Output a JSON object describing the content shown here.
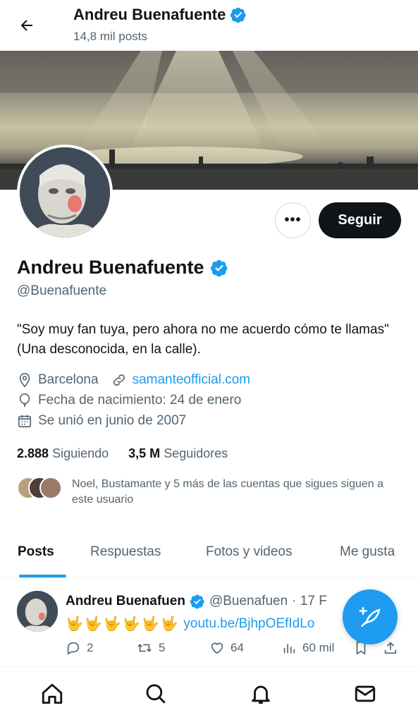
{
  "header": {
    "name": "Andreu Buenafuente",
    "posts_count": "14,8 mil posts"
  },
  "profile": {
    "name": "Andreu Buenafuente",
    "handle": "@Buenafuente",
    "bio": "\"Soy muy fan tuya, pero ahora no me acuerdo cómo te llamas\" (Una desconocida, en la calle).",
    "location": "Barcelona",
    "website": "samanteofficial.com",
    "birthday": "Fecha de nacimiento: 24 de enero",
    "joined": "Se unió en junio de 2007",
    "following_count": "2.888",
    "following_label": "Siguiendo",
    "followers_count": "3,5 M",
    "followers_label": "Seguidores",
    "known_followers": "Noel, Bustamante y 5 más de las cuentas que sigues siguen a este usuario"
  },
  "actions": {
    "more": "•••",
    "follow": "Seguir"
  },
  "tabs": [
    "Posts",
    "Respuestas",
    "Fotos y videos",
    "Me gusta"
  ],
  "tweet": {
    "name": "Andreu Buenafuen",
    "handle": "@Buenafuen",
    "time": "· 17 F",
    "emojis": "🤟🤟🤟🤟🤟🤟",
    "link": "youtu.be/BjhpOEfIdLo",
    "replies": "2",
    "retweets": "5",
    "likes": "64",
    "views": "60 mil"
  },
  "colors": {
    "accent": "#1d9bf0",
    "text": "#0f1419",
    "secondary": "#536471"
  }
}
